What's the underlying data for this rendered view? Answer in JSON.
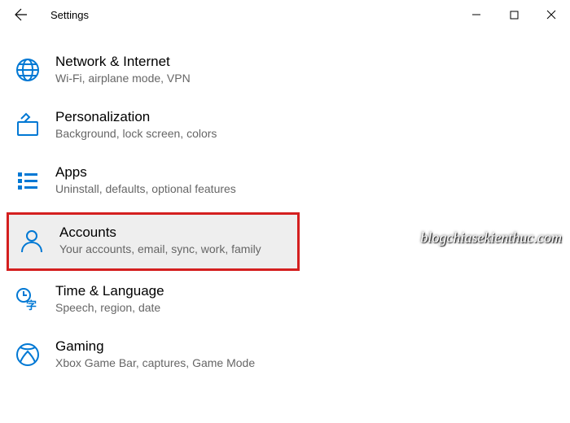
{
  "window": {
    "title": "Settings"
  },
  "items": [
    {
      "title": "Network & Internet",
      "subtitle": "Wi-Fi, airplane mode, VPN"
    },
    {
      "title": "Personalization",
      "subtitle": "Background, lock screen, colors"
    },
    {
      "title": "Apps",
      "subtitle": "Uninstall, defaults, optional features"
    },
    {
      "title": "Accounts",
      "subtitle": "Your accounts, email, sync, work, family"
    },
    {
      "title": "Time & Language",
      "subtitle": "Speech, region, date"
    },
    {
      "title": "Gaming",
      "subtitle": "Xbox Game Bar, captures, Game Mode"
    }
  ],
  "watermark": "blogchiasekienthuc.com",
  "colors": {
    "accent": "#0078D4"
  }
}
